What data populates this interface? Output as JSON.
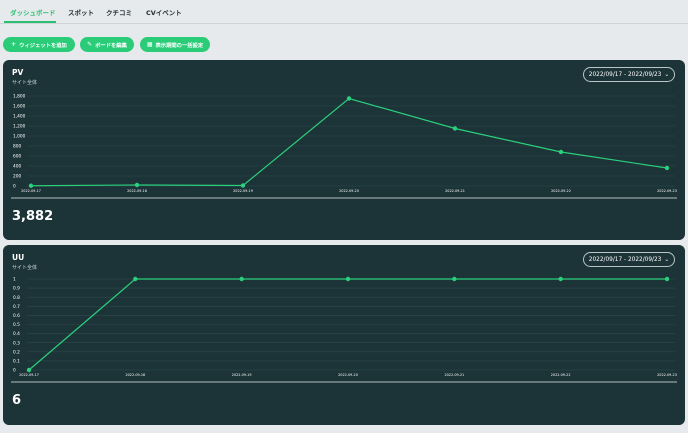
{
  "tabs": [
    {
      "label": "ダッシュボード",
      "active": true
    },
    {
      "label": "スポット",
      "active": false
    },
    {
      "label": "クチコミ",
      "active": false
    },
    {
      "label": "CVイベント",
      "active": false
    }
  ],
  "actions": [
    {
      "icon": "plus-icon",
      "label": "ウィジェットを追加"
    },
    {
      "icon": "edit-icon",
      "label": "ボードを編集"
    },
    {
      "icon": "calendar-icon",
      "label": "表示期間の一括設定"
    }
  ],
  "colors": {
    "accent": "#2bcc78",
    "panel": "#1c3438",
    "line": "#2bd07c"
  },
  "panels": [
    {
      "title": "PV",
      "subtitle": "サイト全体",
      "date_range": "2022/09/17 - 2022/09/23",
      "total": "3,882"
    },
    {
      "title": "UU",
      "subtitle": "サイト全体",
      "date_range": "2022/09/17 - 2022/09/23",
      "total": "6"
    }
  ],
  "chart_data": [
    {
      "type": "line",
      "x": [
        "2022-09-17",
        "2022-09-18",
        "2022-09-19",
        "2022-09-20",
        "2022-09-21",
        "2022-09-22",
        "2022-09-23"
      ],
      "series": [
        {
          "values": [
            5,
            20,
            10,
            1750,
            1150,
            680,
            360
          ]
        }
      ],
      "ylim": [
        0,
        1800
      ],
      "yticks": [
        "0",
        "200",
        "400",
        "600",
        "800",
        "1,000",
        "1,200",
        "1,400",
        "1,600",
        "1,800"
      ],
      "grid": true
    },
    {
      "type": "line",
      "x": [
        "2022-09-17",
        "2022-09-18",
        "2022-09-19",
        "2022-09-20",
        "2022-09-21",
        "2022-09-22",
        "2022-09-23"
      ],
      "series": [
        {
          "values": [
            0,
            1,
            1,
            1,
            1,
            1,
            1
          ]
        }
      ],
      "ylim": [
        0,
        1
      ],
      "yticks": [
        "0",
        "0.1",
        "0.2",
        "0.3",
        "0.4",
        "0.5",
        "0.6",
        "0.7",
        "0.8",
        "0.9",
        "1"
      ],
      "grid": true
    }
  ]
}
